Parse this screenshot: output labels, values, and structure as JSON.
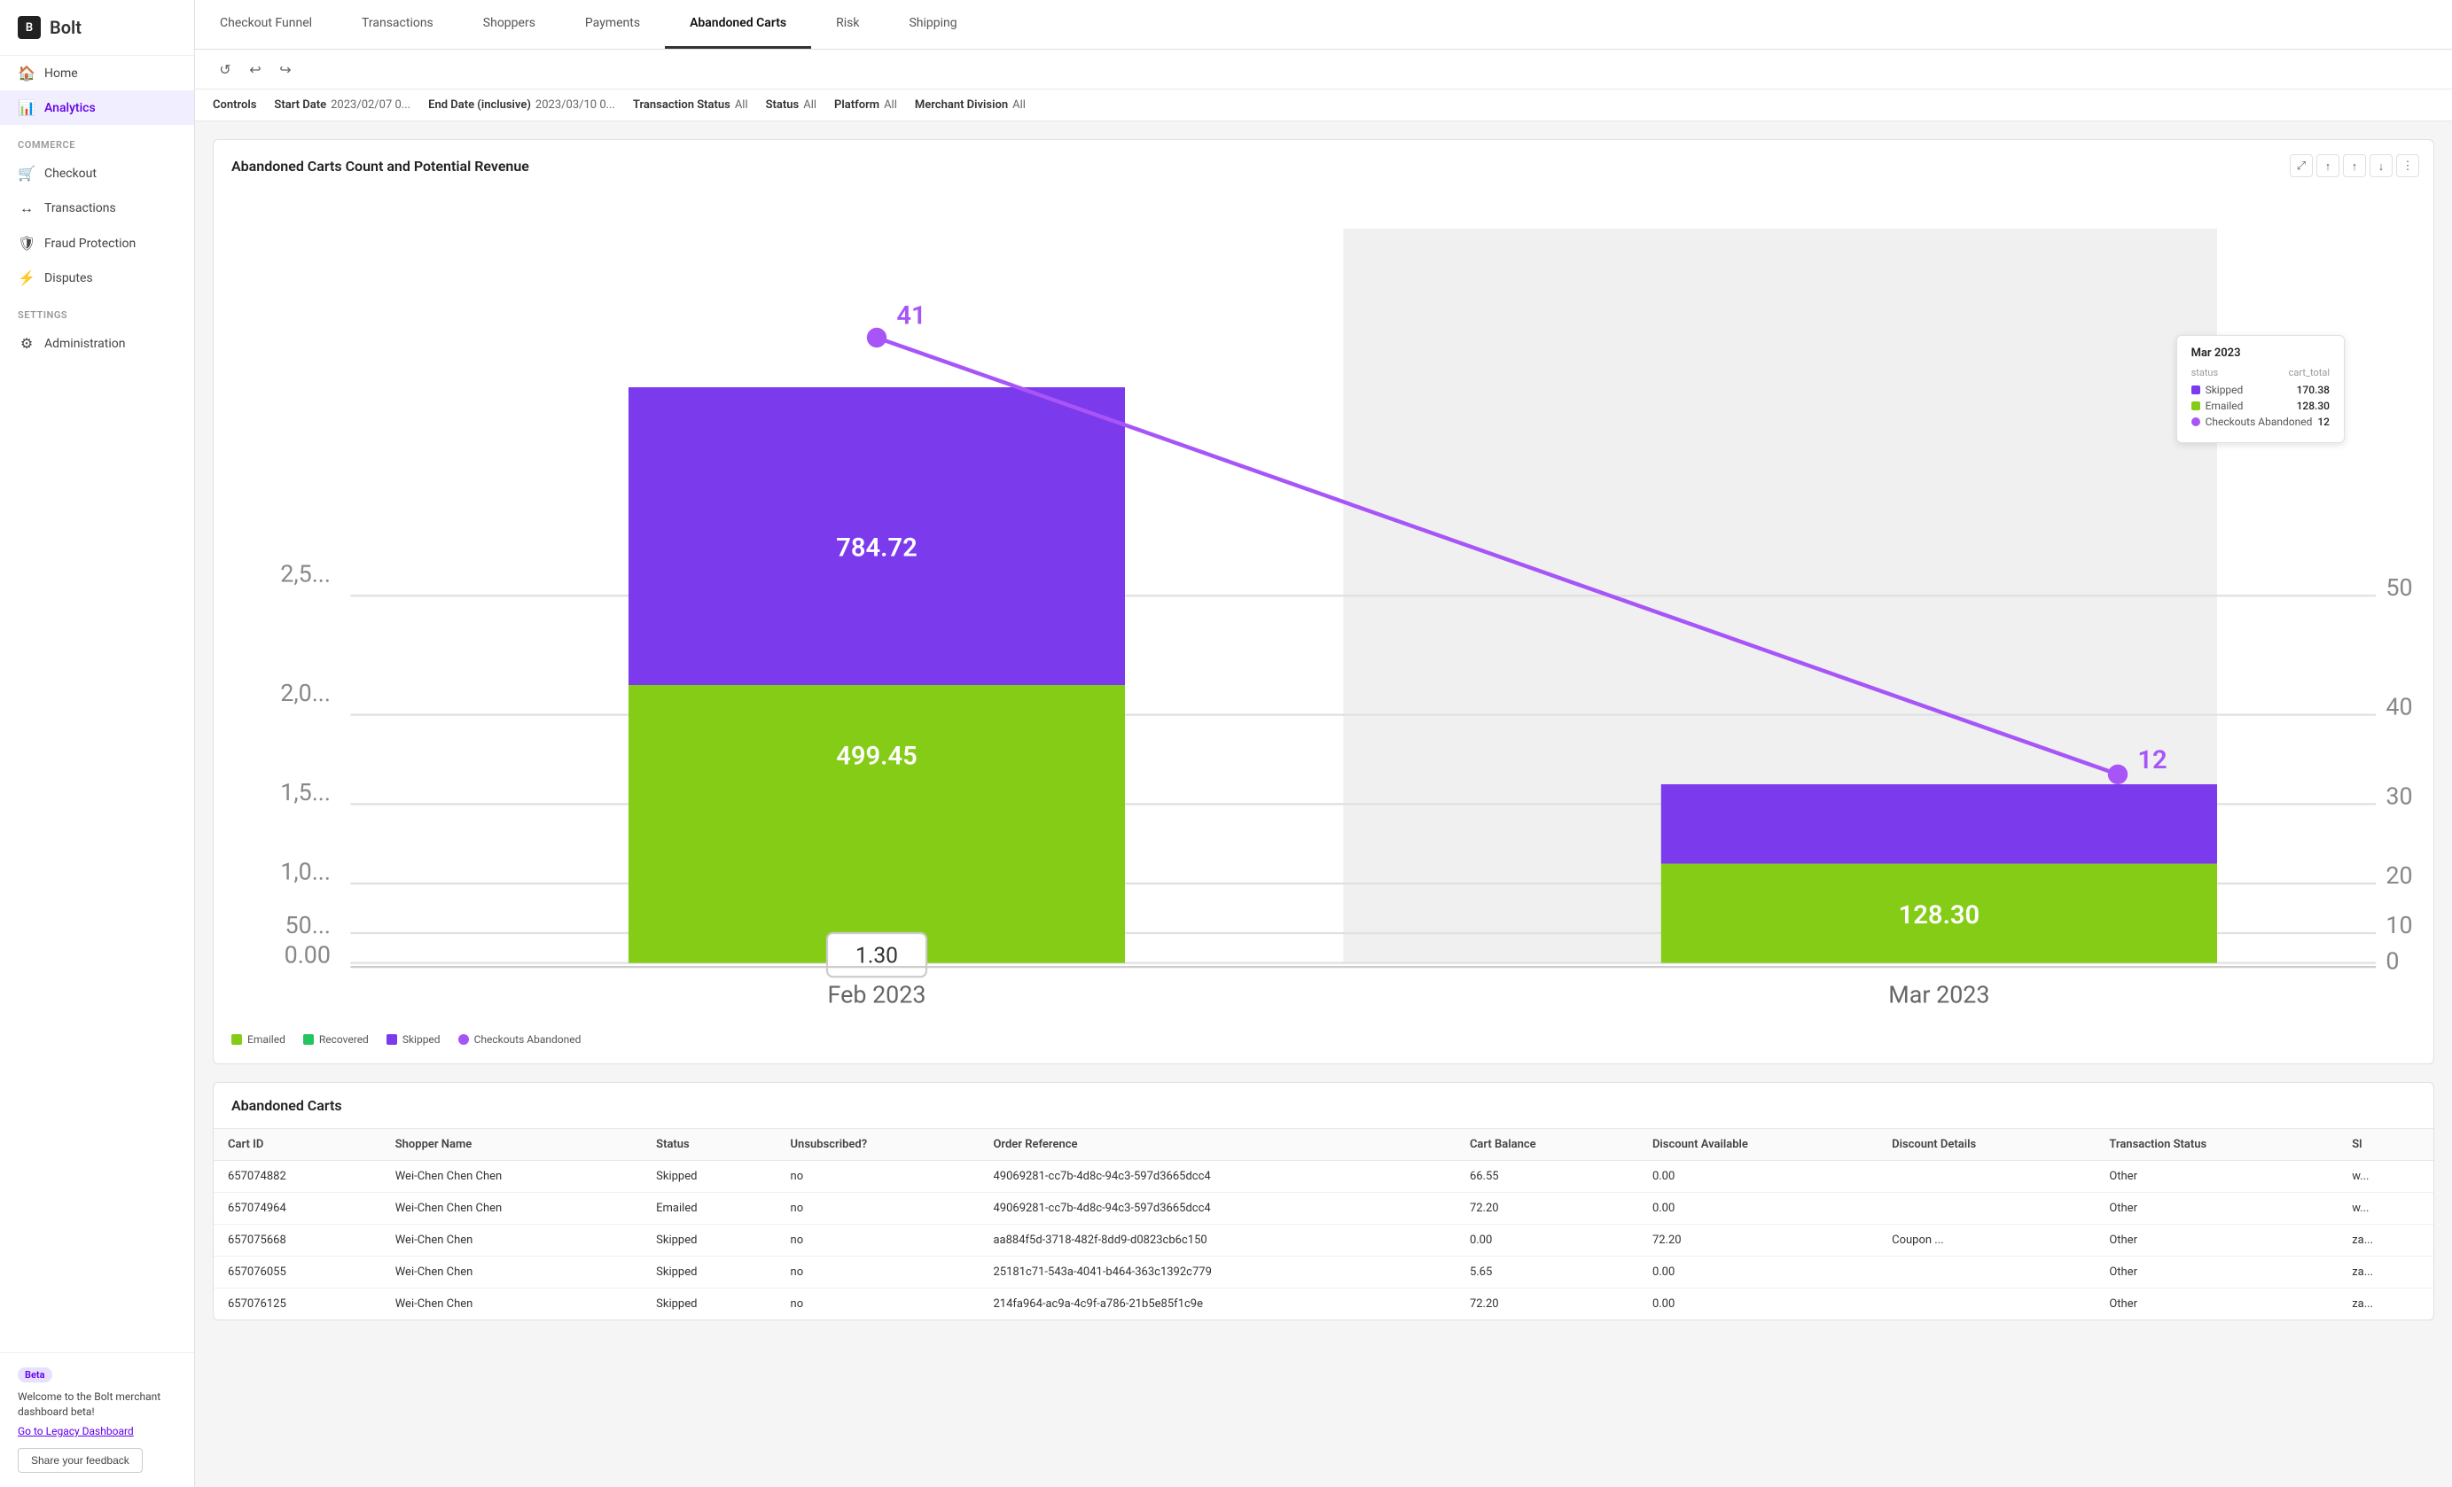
{
  "sidebar": {
    "logo": "Bolt",
    "items": [
      {
        "id": "home",
        "label": "Home",
        "icon": "🏠",
        "active": false
      },
      {
        "id": "analytics",
        "label": "Analytics",
        "icon": "📊",
        "active": true
      }
    ],
    "sections": [
      {
        "label": "COMMERCE",
        "items": [
          {
            "id": "checkout",
            "label": "Checkout",
            "icon": "🛒",
            "active": false
          },
          {
            "id": "transactions",
            "label": "Transactions",
            "icon": "↔",
            "active": false
          },
          {
            "id": "fraud-protection",
            "label": "Fraud Protection",
            "icon": "🛡",
            "active": false
          },
          {
            "id": "disputes",
            "label": "Disputes",
            "icon": "⚡",
            "active": false
          }
        ]
      },
      {
        "label": "SETTINGS",
        "items": [
          {
            "id": "administration",
            "label": "Administration",
            "icon": "⚙",
            "active": false
          }
        ]
      }
    ],
    "beta": {
      "badge": "Beta",
      "message": "Welcome to the Bolt merchant dashboard beta!",
      "link": "Go to Legacy Dashboard",
      "feedback_btn": "Share your feedback"
    }
  },
  "top_tabs": [
    {
      "id": "checkout-funnel",
      "label": "Checkout Funnel",
      "active": false
    },
    {
      "id": "transactions",
      "label": "Transactions",
      "active": false
    },
    {
      "id": "shoppers",
      "label": "Shoppers",
      "active": false
    },
    {
      "id": "payments",
      "label": "Payments",
      "active": false
    },
    {
      "id": "abandoned-carts",
      "label": "Abandoned Carts",
      "active": true
    },
    {
      "id": "risk",
      "label": "Risk",
      "active": false
    },
    {
      "id": "shipping",
      "label": "Shipping",
      "active": false
    }
  ],
  "controls": {
    "label": "Controls",
    "undo_icon": "↺",
    "undo2_icon": "↩",
    "redo_icon": "↪"
  },
  "filters": [
    {
      "id": "start-date",
      "label": "Start Date",
      "value": "2023/02/07 0..."
    },
    {
      "id": "end-date",
      "label": "End Date (inclusive)",
      "value": "2023/03/10 0..."
    },
    {
      "id": "transaction-status",
      "label": "Transaction Status",
      "value": "All"
    },
    {
      "id": "status",
      "label": "Status",
      "value": "All"
    },
    {
      "id": "platform",
      "label": "Platform",
      "value": "All"
    },
    {
      "id": "merchant-division",
      "label": "Merchant Division",
      "value": "All"
    }
  ],
  "chart": {
    "title": "Abandoned Carts Count and Potential Revenue",
    "feb_bar_emailed": 499.45,
    "feb_bar_skipped": 784.72,
    "feb_line_point_label": "41",
    "feb_dot_label": "1.30",
    "mar_bar_emailed": 128.3,
    "mar_bar_skipped": 170.38,
    "mar_line_point_label": "12",
    "tooltip": {
      "title": "Mar 2023",
      "status_label": "status",
      "cart_total_label": "cart_total",
      "rows": [
        {
          "color": "#7c3aed",
          "label": "Skipped",
          "value": "170.38"
        },
        {
          "color": "#84cc16",
          "label": "Emailed",
          "value": "128.30"
        },
        {
          "color": "#a855f7",
          "label": "Checkouts Abandoned",
          "value": "12"
        }
      ]
    },
    "legend": [
      {
        "id": "emailed",
        "label": "Emailed",
        "color": "#84cc16",
        "shape": "rect"
      },
      {
        "id": "recovered",
        "label": "Recovered",
        "color": "#22c55e",
        "shape": "rect"
      },
      {
        "id": "skipped",
        "label": "Skipped",
        "color": "#7c3aed",
        "shape": "rect"
      },
      {
        "id": "checkouts-abandoned",
        "label": "Checkouts Abandoned",
        "color": "#a855f7",
        "shape": "circle"
      }
    ],
    "ctrl_btns": [
      "⤢",
      "↑",
      "↑",
      "↓",
      "⋮"
    ]
  },
  "table": {
    "title": "Abandoned Carts",
    "columns": [
      "Cart ID",
      "Shopper Name",
      "Status",
      "Unsubscribed?",
      "Order Reference",
      "Cart Balance",
      "Discount Available",
      "Discount Details",
      "Transaction Status",
      "Sl"
    ],
    "rows": [
      {
        "cart_id": "657074882",
        "shopper_name": "Wei-Chen Chen Chen",
        "status": "Skipped",
        "unsubscribed": "no",
        "order_ref": "49069281-cc7b-4d8c-94c3-597d3665dcc4",
        "cart_balance": "66.55",
        "discount_available": "0.00",
        "discount_details": "",
        "transaction_status": "Other",
        "sl": "w..."
      },
      {
        "cart_id": "657074964",
        "shopper_name": "Wei-Chen Chen Chen",
        "status": "Emailed",
        "unsubscribed": "no",
        "order_ref": "49069281-cc7b-4d8c-94c3-597d3665dcc4",
        "cart_balance": "72.20",
        "discount_available": "0.00",
        "discount_details": "",
        "transaction_status": "Other",
        "sl": "w..."
      },
      {
        "cart_id": "657075668",
        "shopper_name": "Wei-Chen Chen",
        "status": "Skipped",
        "unsubscribed": "no",
        "order_ref": "aa884f5d-3718-482f-8dd9-d0823cb6c150",
        "cart_balance": "0.00",
        "discount_available": "72.20",
        "discount_details": "Coupon ...",
        "transaction_status": "Other",
        "sl": "za..."
      },
      {
        "cart_id": "657076055",
        "shopper_name": "Wei-Chen Chen",
        "status": "Skipped",
        "unsubscribed": "no",
        "order_ref": "25181c71-543a-4041-b464-363c1392c779",
        "cart_balance": "5.65",
        "discount_available": "0.00",
        "discount_details": "",
        "transaction_status": "Other",
        "sl": "za..."
      },
      {
        "cart_id": "657076125",
        "shopper_name": "Wei-Chen Chen",
        "status": "Skipped",
        "unsubscribed": "no",
        "order_ref": "214fa964-ac9a-4c9f-a786-21b5e85f1c9e",
        "cart_balance": "72.20",
        "discount_available": "0.00",
        "discount_details": "",
        "transaction_status": "Other",
        "sl": "za..."
      }
    ]
  }
}
